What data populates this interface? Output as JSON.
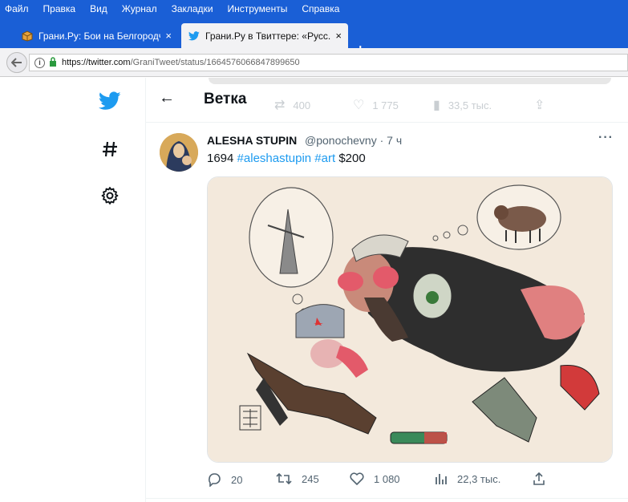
{
  "browser": {
    "menu": [
      "Файл",
      "Правка",
      "Вид",
      "Журнал",
      "Закладки",
      "Инструменты",
      "Справка"
    ],
    "tabs": [
      {
        "title": "Грани.Ру: Бои на Белгородч...",
        "close": "×"
      },
      {
        "title": "Грани.Ру в Твиттере: «Русс...",
        "close": "×"
      }
    ],
    "new_tab": "+",
    "url_host": "https://twitter.com",
    "url_path": "/GraniTweet/status/1664576066847899650"
  },
  "header": {
    "back": "←",
    "title": "Ветка",
    "ghost_retweets": "400",
    "ghost_likes": "1 775",
    "ghost_views": "33,5 тыс."
  },
  "tweet": {
    "author_name": "ALESHA STUPIN",
    "handle_time": "@ponochevny · 7 ч",
    "more": "···",
    "text_prefix": "1694 ",
    "tag1": "#aleshastupin",
    "tag2": "#art",
    "text_suffix": " $200",
    "replies": "20",
    "retweets": "245",
    "likes": "1 080",
    "views": "22,3 тыс."
  },
  "colors": {
    "firefox_blue": "#1a5fd6",
    "twitter_blue": "#1d9bf0",
    "text": "#0f1419",
    "muted": "#536471"
  }
}
